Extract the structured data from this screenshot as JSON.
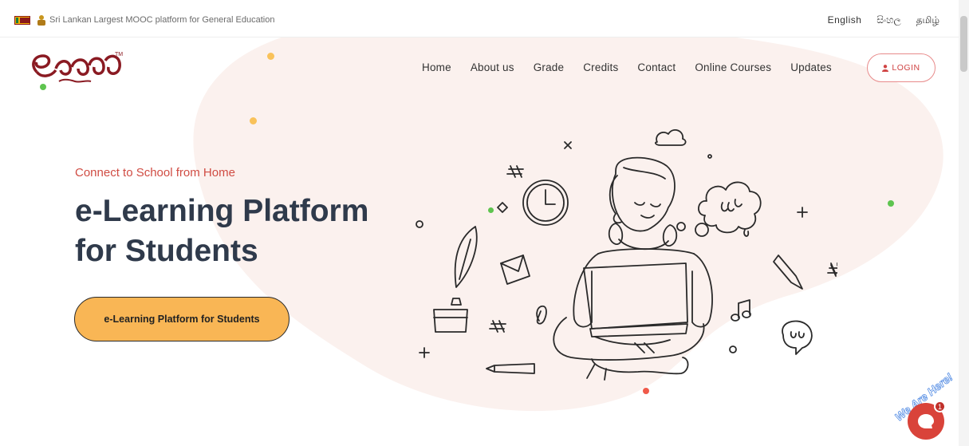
{
  "topbar": {
    "tagline": "Sri Lankan Largest MOOC platform for General Education",
    "languages": [
      "English",
      "සිංහල",
      "தமிழ்"
    ]
  },
  "header": {
    "logo_alt": "e-thaksalawa logo",
    "nav": [
      "Home",
      "About us",
      "Grade",
      "Credits",
      "Contact",
      "Online Courses",
      "Updates"
    ],
    "login_label": "LOGIN"
  },
  "hero": {
    "subtitle": "Connect to School from Home",
    "title_line1": "e-Learning Platform",
    "title_line2": "for Students",
    "cta_label": "e-Learning Platform for Students"
  },
  "chat": {
    "label": "We Are Here!",
    "badge_count": "1"
  },
  "colors": {
    "accent_red": "#d04c43",
    "cta_orange": "#f9b655",
    "blob": "#fbf1ee",
    "dot_green": "#5ec44f",
    "dot_yellow": "#f9c25a"
  },
  "icons": [
    "sri-lanka-flag-icon",
    "national-emblem-icon",
    "user-icon",
    "chat-icon"
  ]
}
